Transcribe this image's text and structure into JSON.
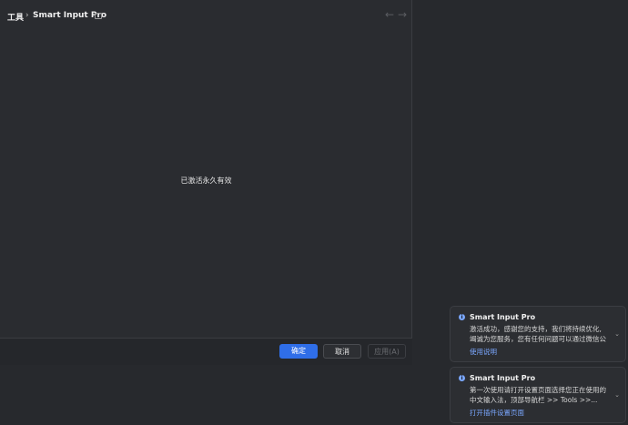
{
  "window": {
    "breadcrumb_root": "工具",
    "breadcrumb_sep": "›",
    "breadcrumb_current": "Smart Input Pro",
    "nav_back": "←",
    "nav_forward": "→",
    "status_text": "已激活永久有效"
  },
  "footer": {
    "ok_label": "确定",
    "cancel_label": "取消",
    "apply_label": "应用(A)"
  },
  "notifications": [
    {
      "title": "Smart Input Pro",
      "line1": "激活成功，感谢您的支持，我们将持续优化,",
      "line2": "竭诚为您服务，您有任何问题可以通过微信公",
      "link": "使用说明"
    },
    {
      "title": "Smart Input Pro",
      "line1": "第一次使用请打开设置页面选择您正在使用的",
      "line2": "中文输入法，顶部导航栏 >> Tools >>...",
      "link": "打开插件设置页面"
    }
  ],
  "icons": {
    "info": "i",
    "chevron": "⌄"
  },
  "colors": {
    "accent": "#2f6ee8",
    "link": "#7aa7ff",
    "background": "#27292d"
  }
}
